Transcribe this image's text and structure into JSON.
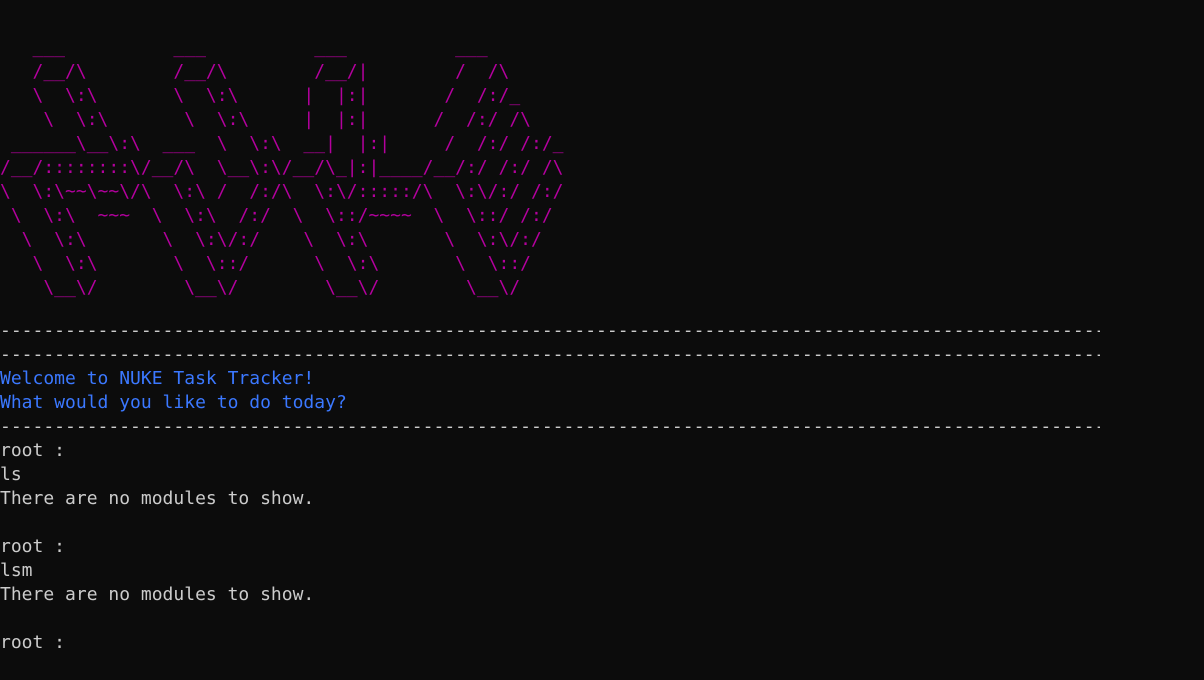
{
  "colors": {
    "background": "#0c0c0c",
    "text": "#cccccc",
    "logo": "#b4009e",
    "welcome": "#3b78ff"
  },
  "logo_art": "   ___          ___          ___          ___\n   /__/\\        /__/\\        /__/|        /  /\\\n   \\  \\:\\       \\  \\:\\      |  |:|       /  /:/_\n    \\  \\:\\       \\  \\:\\     |  |:|      /  /:/ /\\\n ______\\__\\:\\  ___  \\  \\:\\  __|  |:|     /  /:/ /:/_\n/__/::::::::\\/__/\\  \\__\\:\\/__/\\_|:|____/__/:/ /:/ /\\\n\\  \\:\\~~\\~~\\/\\  \\:\\ /  /:/\\  \\:\\/:::::/\\  \\:\\/:/ /:/\n \\  \\:\\  ~~~  \\  \\:\\  /:/  \\  \\::/~~~~  \\  \\::/ /:/\n  \\  \\:\\       \\  \\:\\/:/    \\  \\:\\       \\  \\:\\/:/\n   \\  \\:\\       \\  \\::/      \\  \\:\\       \\  \\::/\n    \\__\\/        \\__\\/        \\__\\/        \\__\\/",
  "separator": "-----------------------------------------------------------------------------------------------------------------------",
  "welcome": {
    "line1": "Welcome to NUKE Task Tracker!",
    "line2": "What would you like to do today?"
  },
  "session": {
    "entry1": {
      "prompt": "root :",
      "command": "ls",
      "output": "There are no modules to show."
    },
    "entry2": {
      "prompt": "root :",
      "command": "lsm",
      "output": "There are no modules to show."
    },
    "entry3": {
      "prompt": "root :"
    }
  }
}
